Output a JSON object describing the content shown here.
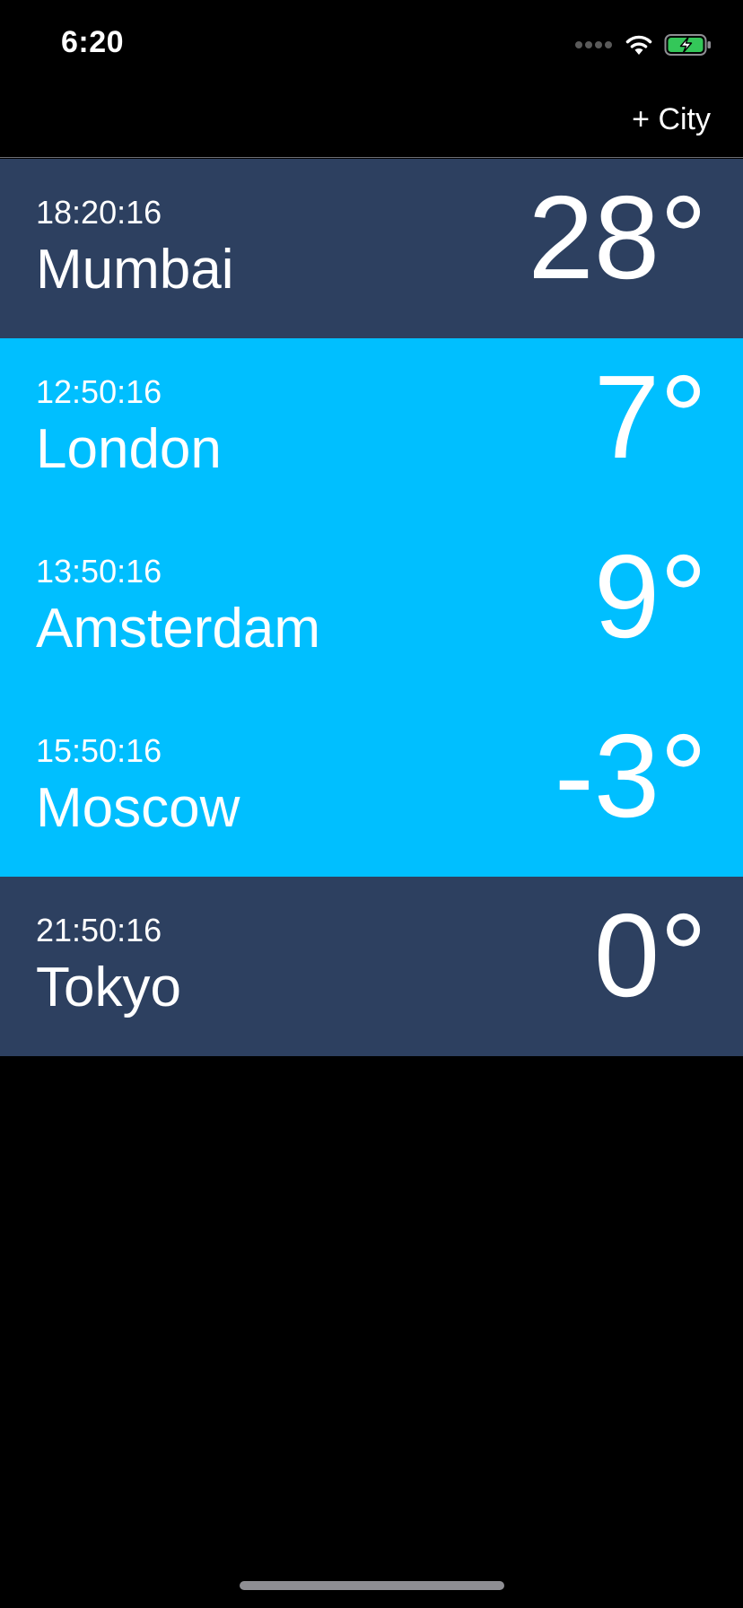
{
  "status_bar": {
    "time": "6:20",
    "icons": [
      "cellular-signal-icon",
      "wifi-icon",
      "battery-charging-icon"
    ],
    "battery_color": "#34c759"
  },
  "nav": {
    "add_city_label": "+ City"
  },
  "colors": {
    "night_row": "#2d4060",
    "day_row": "#00bfff",
    "background": "#000000"
  },
  "cities": [
    {
      "time": "18:20:16",
      "name": "Mumbai",
      "temp": "28°",
      "theme": "night"
    },
    {
      "time": "12:50:16",
      "name": "London",
      "temp": "7°",
      "theme": "day"
    },
    {
      "time": "13:50:16",
      "name": "Amsterdam",
      "temp": "9°",
      "theme": "day"
    },
    {
      "time": "15:50:16",
      "name": "Moscow",
      "temp": "-3°",
      "theme": "day"
    },
    {
      "time": "21:50:16",
      "name": "Tokyo",
      "temp": "0°",
      "theme": "night"
    }
  ]
}
